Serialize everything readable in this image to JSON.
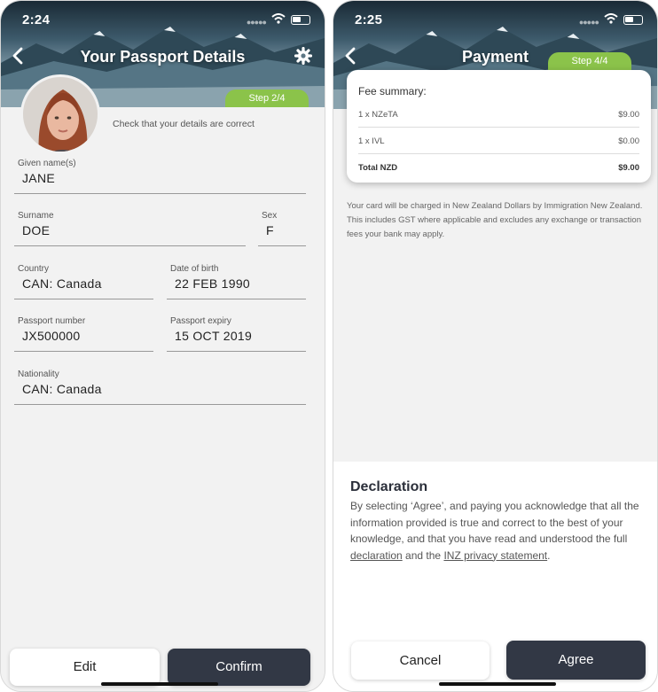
{
  "colors": {
    "accent_green": "#8bc34a",
    "dark_button": "#323845",
    "background": "#f2f2f2"
  },
  "left_screen": {
    "status_time": "2:24",
    "nav_title": "Your Passport Details",
    "step": "Step 2/4",
    "check_text": "Check that your details are correct",
    "fields": {
      "given_names": {
        "label": "Given name(s)",
        "value": "JANE"
      },
      "surname": {
        "label": "Surname",
        "value": "DOE"
      },
      "sex": {
        "label": "Sex",
        "value": "F"
      },
      "country": {
        "label": "Country",
        "value": "CAN: Canada"
      },
      "dob": {
        "label": "Date of birth",
        "value": "22 FEB 1990"
      },
      "passport_number": {
        "label": "Passport number",
        "value": "JX500000"
      },
      "passport_expiry": {
        "label": "Passport expiry",
        "value": "15 OCT 2019"
      },
      "nationality": {
        "label": "Nationality",
        "value": "CAN: Canada"
      }
    },
    "buttons": {
      "edit": "Edit",
      "confirm": "Confirm"
    }
  },
  "right_screen": {
    "status_time": "2:25",
    "nav_title": "Payment",
    "step": "Step 4/4",
    "fee_summary": {
      "title": "Fee summary:",
      "rows": [
        {
          "name": "1 x NZeTA",
          "amount": "$9.00"
        },
        {
          "name": "1 x IVL",
          "amount": "$0.00"
        }
      ],
      "total": {
        "name": "Total NZD",
        "amount": "$9.00"
      }
    },
    "charge_note": "Your card will be charged in New Zealand Dollars by Immigration New Zealand. This includes GST where applicable and excludes any exchange or transaction fees your bank may apply.",
    "declaration": {
      "title": "Declaration",
      "text_before": "By selecting ‘Agree’, and paying you acknowledge that all the information provided is true and correct to the best of your knowledge, and that you have read and understood the full ",
      "link_declaration": "declaration",
      "text_middle": " and the ",
      "link_privacy": "INZ privacy statement",
      "text_end": "."
    },
    "buttons": {
      "cancel": "Cancel",
      "agree": "Agree"
    }
  }
}
